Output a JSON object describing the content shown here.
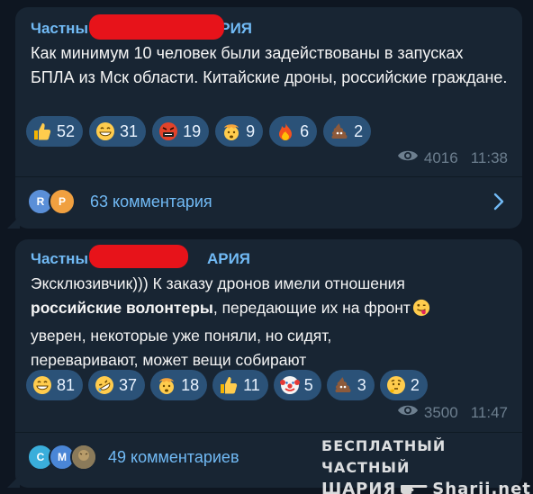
{
  "messages": [
    {
      "sender_prefix": "Частны",
      "sender_suffix": "АРИЯ",
      "text": "Как минимум 10 человек были задействованы в запусках БПЛА из Мск области. Китайские дроны, российские граждане.",
      "reactions": [
        {
          "icon": "thumbs-up-icon",
          "count": "52"
        },
        {
          "icon": "grin-icon",
          "count": "31"
        },
        {
          "icon": "cursing-face-icon",
          "count": "19"
        },
        {
          "icon": "exploding-head-icon",
          "count": "9"
        },
        {
          "icon": "fire-icon",
          "count": "6"
        },
        {
          "icon": "poop-icon",
          "count": "2"
        }
      ],
      "views": "4016",
      "time": "11:38",
      "comment_avatars": [
        {
          "letter": "R",
          "color": "#5a8fd8"
        },
        {
          "letter": "P",
          "color": "#f0a040"
        }
      ],
      "comments_label": "63 комментария"
    },
    {
      "sender_prefix": "Частны",
      "sender_suffix": "АРИЯ",
      "text_line1": "Эксклюзивчик))) К заказу дронов имели отношения",
      "text_bold": "российские волонтеры",
      "text_after_bold": ", передающие их на фронт",
      "text_line3": "уверен, некоторые уже поняли, но сидят,",
      "text_line4": "переваривают, может вещи собирают",
      "reactions": [
        {
          "icon": "grin-icon",
          "count": "81"
        },
        {
          "icon": "rofl-icon",
          "count": "37"
        },
        {
          "icon": "exploding-head-icon",
          "count": "18"
        },
        {
          "icon": "thumbs-up-icon",
          "count": "11"
        },
        {
          "icon": "clown-icon",
          "count": "5"
        },
        {
          "icon": "poop-icon",
          "count": "3"
        },
        {
          "icon": "thinking-icon",
          "count": "2"
        }
      ],
      "views": "3500",
      "time": "11:47",
      "comment_avatars": [
        {
          "letter": "C",
          "color": "#3aaedb"
        },
        {
          "letter": "M",
          "color": "#4a86d6"
        },
        {
          "letter": "",
          "color": "#8a7a5a"
        }
      ],
      "comments_label": "49 комментариев"
    }
  ],
  "watermark": {
    "line1": "БЕСПЛАТНЫЙ ЧАСТНЫЙ",
    "line2_left": "ШАРИЯ",
    "line2_right": "Sharij.net"
  },
  "colors": {
    "background": "#0e1621",
    "bubble": "#182533",
    "accent": "#71baf5",
    "reaction_bg": "#2b5278",
    "redaction": "#e7131a"
  }
}
